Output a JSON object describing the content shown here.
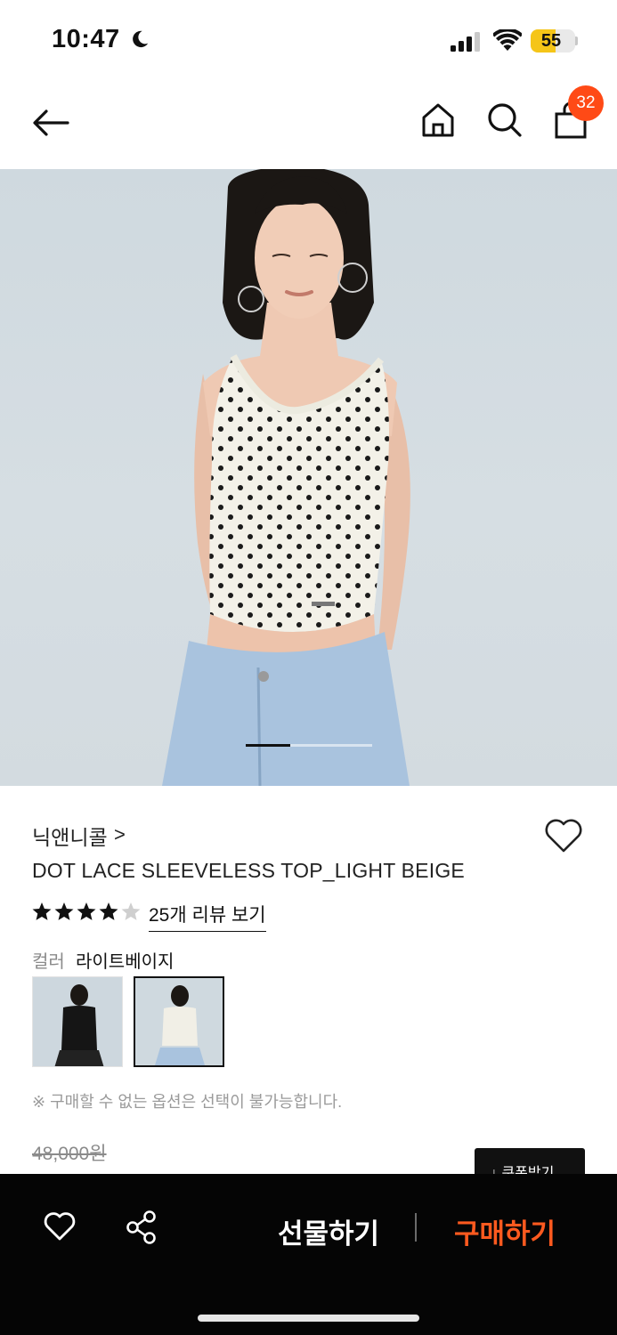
{
  "status_bar": {
    "time": "10:47",
    "battery_level": "55",
    "battery_fraction": 0.55
  },
  "nav": {
    "cart_count": "32"
  },
  "product_images": {
    "pager_position": 0.35
  },
  "product": {
    "brand": "닉앤니콜",
    "brand_chevron": ">",
    "title": "DOT LACE SLEEVELESS TOP_LIGHT BEIGE",
    "rating_stars": 4,
    "rating_max": 5,
    "review_link": "25개 리뷰 보기",
    "color_label": "컬러",
    "color_value": "라이트베이지",
    "notice": "※ 구매할 수 없는 옵션은 선택이 불가능합니다.",
    "original_price": "48,000원",
    "coupon_button": "↓ 쿠폰받기"
  },
  "bottom_bar": {
    "gift_button": "선물하기",
    "buy_button": "구매하기"
  },
  "colors": {
    "accent": "#ff4a16",
    "buy": "#ff5a1f",
    "bottom_bar_bg": "#050505"
  }
}
